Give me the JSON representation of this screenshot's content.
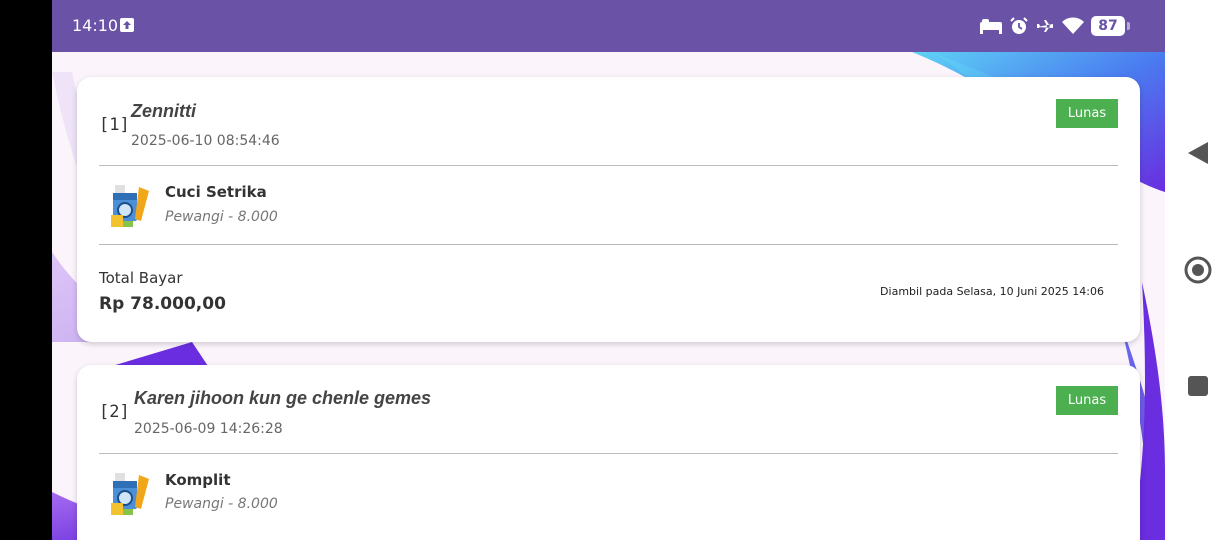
{
  "status_bar": {
    "time": "14:10",
    "battery": "87",
    "icons": [
      "upload-icon",
      "bed-icon",
      "alarm-icon",
      "airplane-icon",
      "wifi-icon",
      "battery-icon"
    ]
  },
  "orders": [
    {
      "index": "[1]",
      "customer": "Zennitti",
      "datetime": "2025-06-10 08:54:46",
      "status": "Lunas",
      "service": {
        "name": "Cuci Setrika",
        "detail": "Pewangi - 8.000"
      },
      "total_label": "Total Bayar",
      "total_amount": "Rp 78.000,00",
      "pickup": "Diambil pada Selasa, 10 Juni 2025 14:06"
    },
    {
      "index": "[2]",
      "customer": "Karen jihoon kun ge chenle gemes",
      "datetime": "2025-06-09 14:26:28",
      "status": "Lunas",
      "service": {
        "name": "Komplit",
        "detail": "Pewangi - 8.000"
      }
    }
  ],
  "colors": {
    "status_bar": "#6a53a6",
    "badge": "#4caf50",
    "background": "#fbf4fb"
  }
}
